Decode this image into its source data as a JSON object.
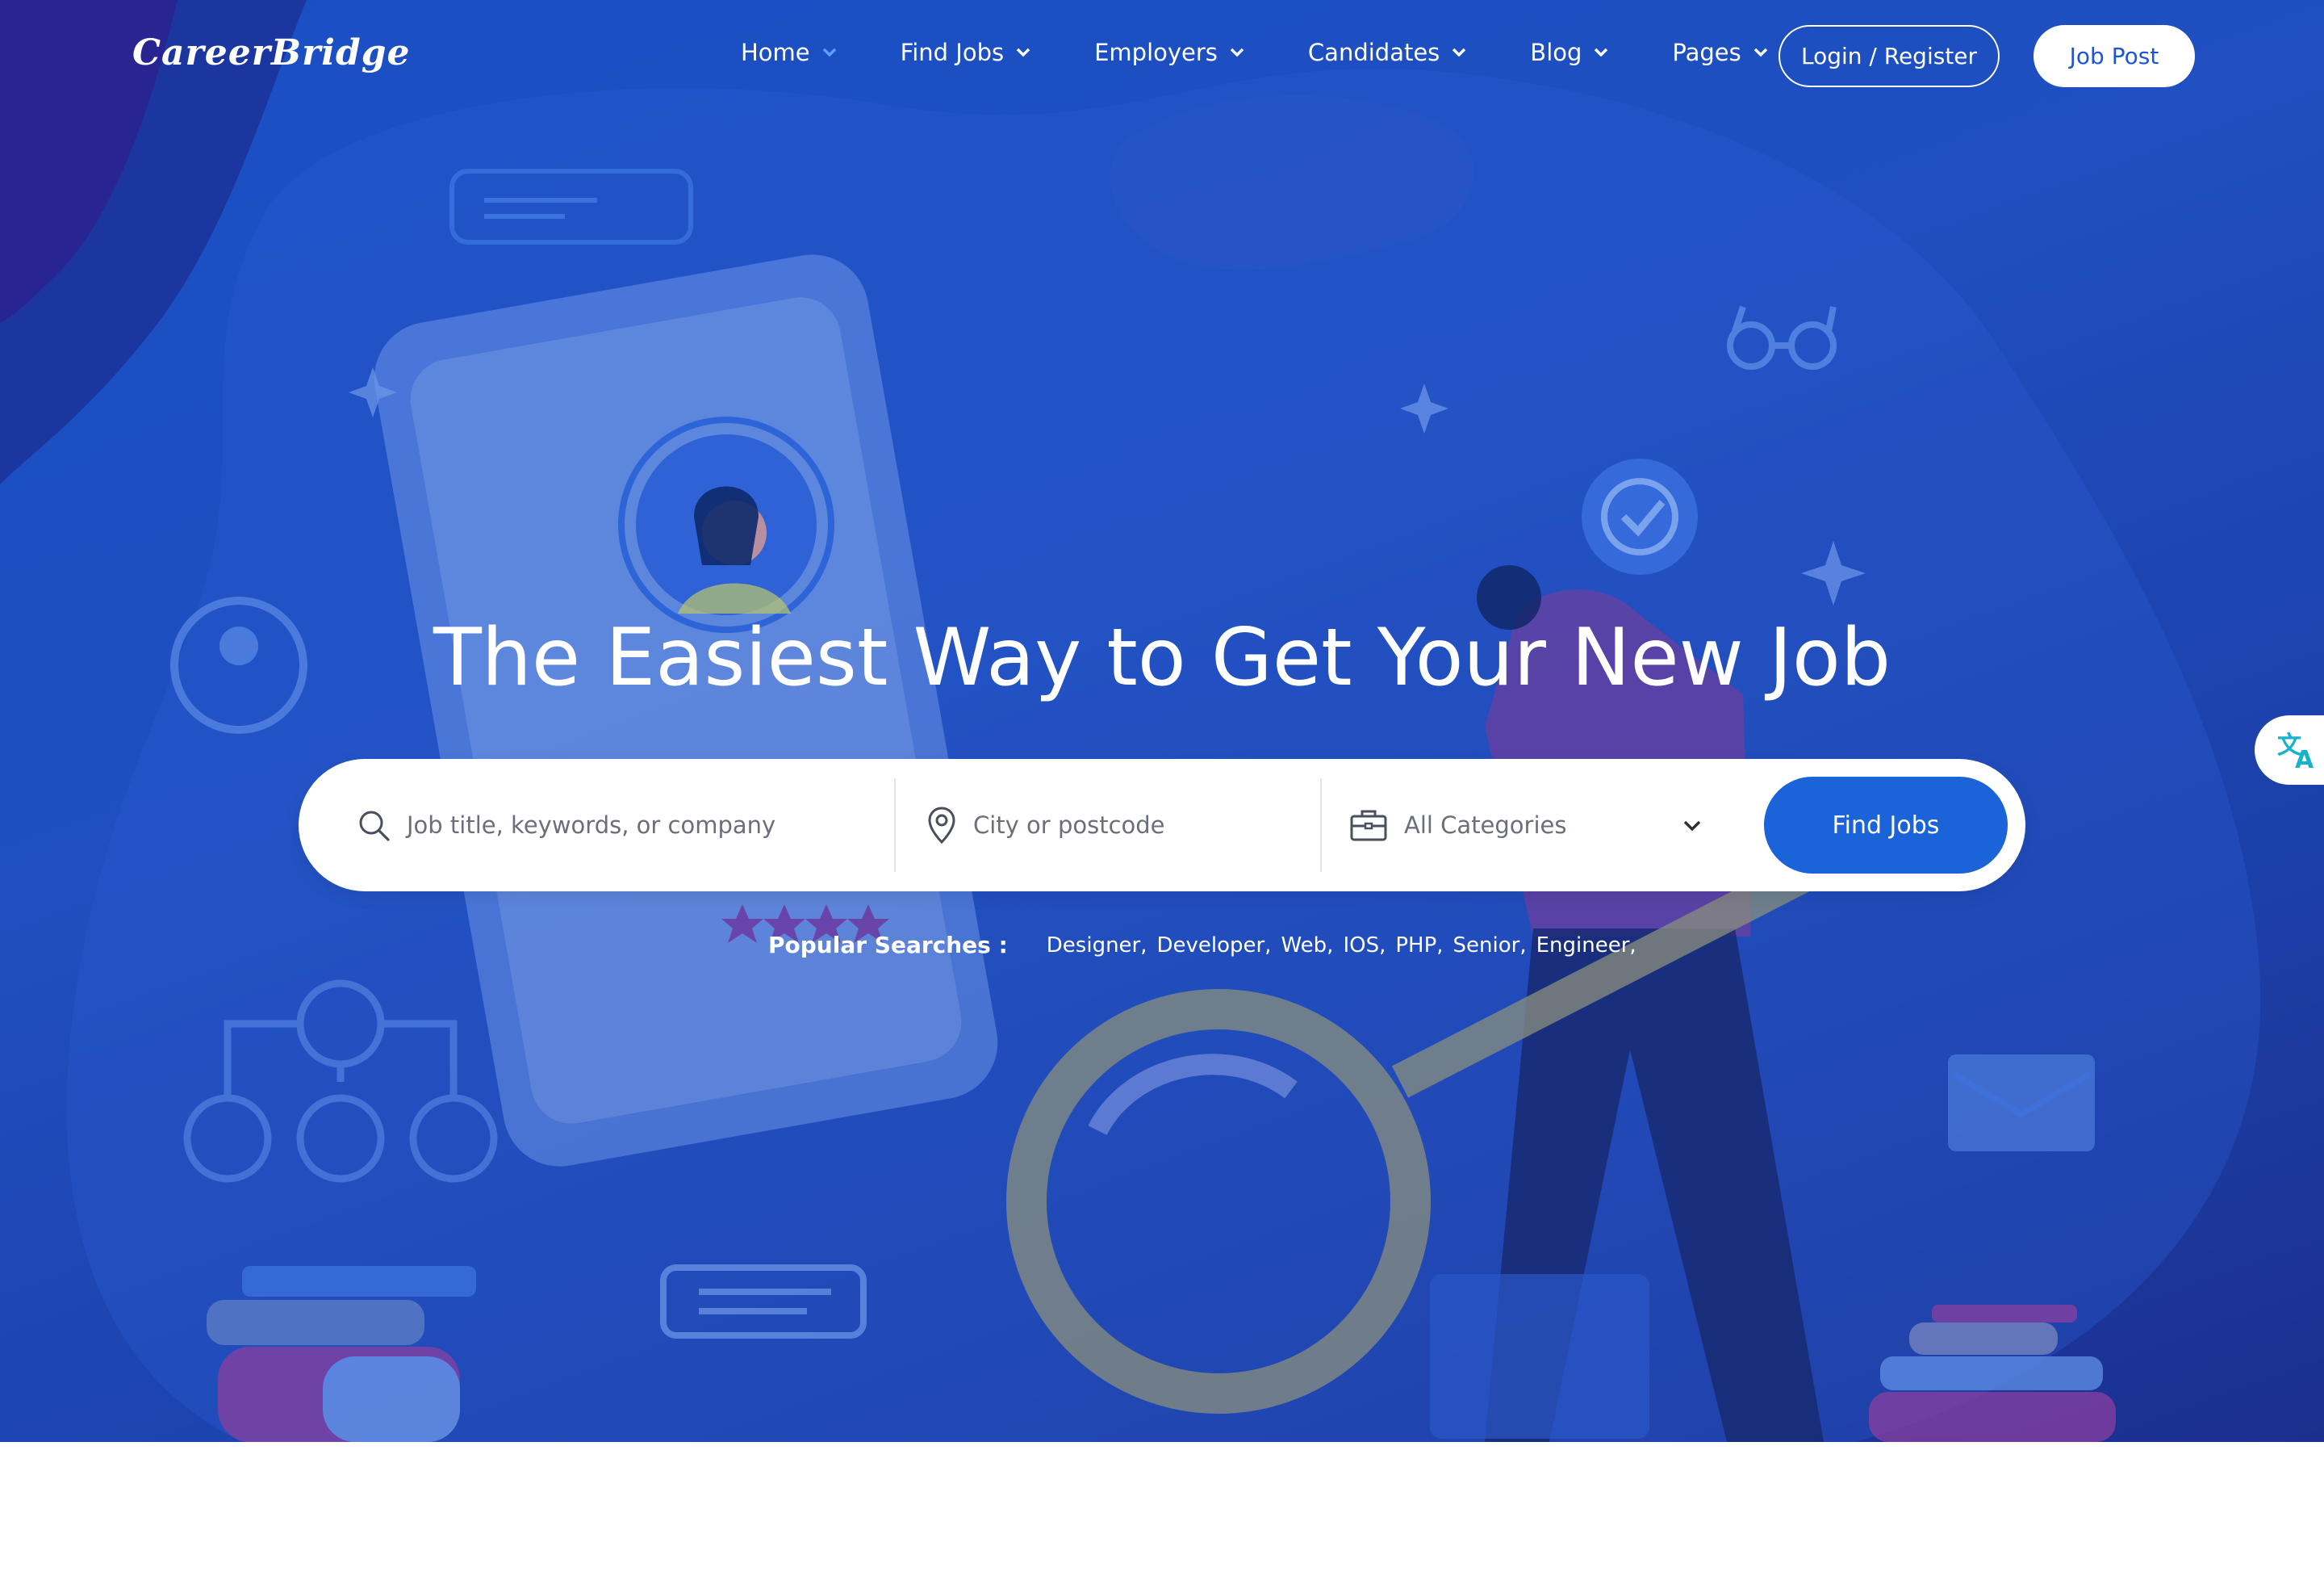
{
  "brand": {
    "name": "CareerBridge"
  },
  "nav": {
    "items": [
      {
        "label": "Home",
        "active": true
      },
      {
        "label": "Find Jobs"
      },
      {
        "label": "Employers"
      },
      {
        "label": "Candidates"
      },
      {
        "label": "Blog"
      },
      {
        "label": "Pages"
      }
    ],
    "login_label": "Login / Register",
    "post_label": "Job Post"
  },
  "hero": {
    "title": "The Easiest Way to Get Your New Job"
  },
  "search": {
    "keyword_placeholder": "Job title, keywords, or company",
    "location_placeholder": "City or postcode",
    "category_value": "All Categories",
    "submit_label": "Find Jobs"
  },
  "popular": {
    "label": "Popular Searches :",
    "tags": [
      "Designer,",
      "Developer,",
      "Web,",
      "IOS,",
      "PHP,",
      "Senior,",
      "Engineer,"
    ]
  },
  "icons": {
    "search": "search-icon",
    "location": "location-pin-icon",
    "category": "briefcase-icon",
    "chevron": "chevron-down-icon",
    "translate": "translate-icon"
  },
  "colors": {
    "hero_bg": "#1f4fc0",
    "accent": "#1a63d8",
    "active_nav_chevron": "#5aa1ff",
    "translate_icon": "#18b3c8"
  }
}
